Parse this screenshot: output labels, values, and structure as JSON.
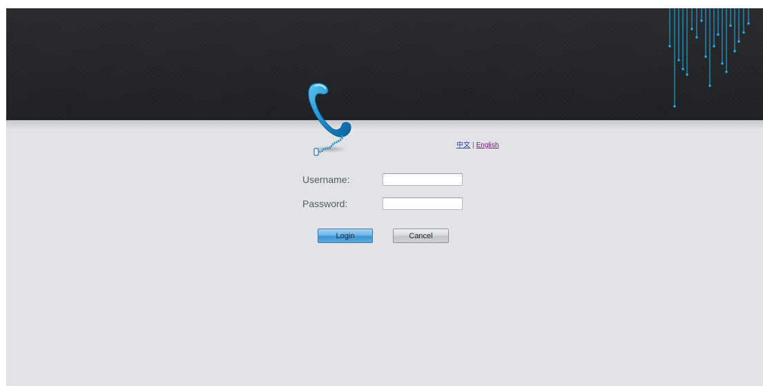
{
  "header": {
    "logo_icon": "telephone-handset-icon",
    "accent_color": "#1aa3d9"
  },
  "language": {
    "chinese_label": "中文",
    "separator": "|",
    "english_label": "English"
  },
  "login_form": {
    "username_label": "Username:",
    "username_value": "",
    "password_label": "Password:",
    "password_value": "",
    "login_button": "Login",
    "cancel_button": "Cancel"
  }
}
